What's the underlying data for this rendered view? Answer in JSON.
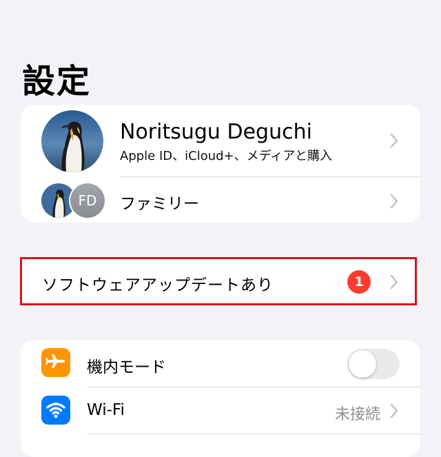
{
  "header": {
    "title": "設定"
  },
  "profile": {
    "name": "Noritsugu Deguchi",
    "subtitle": "Apple ID、iCloud+、メディアと購入",
    "avatar_icon": "penguin-photo"
  },
  "family": {
    "label": "ファミリー",
    "member_initials": "FD"
  },
  "update": {
    "label": "ソフトウェアアップデートあり",
    "badge_count": "1",
    "badge_color": "#ff3b30",
    "highlight_color": "#d9111a"
  },
  "settings": {
    "items": [
      {
        "label": "機内モード",
        "icon": "airplane-icon",
        "icon_color": "#ff9500",
        "toggle_on": false
      },
      {
        "label": "Wi-Fi",
        "icon": "wifi-icon",
        "icon_color": "#007aff",
        "value": "未接続"
      }
    ]
  }
}
